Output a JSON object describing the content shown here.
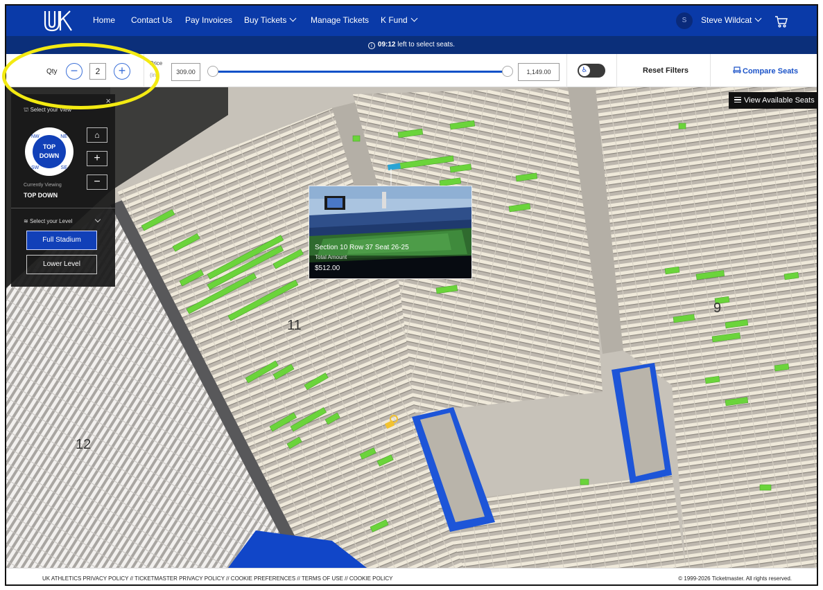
{
  "nav": {
    "logo": "UK",
    "items": [
      {
        "label": "Home",
        "dropdown": false
      },
      {
        "label": "Contact Us",
        "dropdown": false
      },
      {
        "label": "Pay Invoices",
        "dropdown": false
      },
      {
        "label": "Buy Tickets",
        "dropdown": true
      },
      {
        "label": "Manage Tickets",
        "dropdown": false
      },
      {
        "label": "K Fund",
        "dropdown": true
      }
    ],
    "user_initial": "S",
    "user_name": "Steve Wildcat",
    "cart_icon": "cart-icon"
  },
  "timer": {
    "icon": "info-icon",
    "time": "09:12",
    "text": " left to select seats."
  },
  "filters": {
    "qty_label": "Qty",
    "qty_value": "2",
    "minus": "−",
    "plus": "+",
    "price_label": "Price",
    "price_sub": "(in",
    "price_min": "309.00",
    "price_max": "1,149.00",
    "accessibility_symbol": "♿",
    "reset_label": "Reset Filters",
    "compare_label": "Compare Seats"
  },
  "view_panel": {
    "close": "×",
    "select_view_label": "Select your View",
    "compass_center": [
      "TOP",
      "DOWN"
    ],
    "compass_dirs": [
      "NW",
      "NE",
      "SW",
      "SE"
    ],
    "currently_viewing_label": "Currently Viewing",
    "current_view": "TOP DOWN",
    "home_icon": "home-icon",
    "zoom_in": "+",
    "zoom_out": "−",
    "select_level_label": "Select your Level",
    "levels": [
      "Full Stadium",
      "Lower Level"
    ],
    "selected_level": "Full Stadium"
  },
  "map": {
    "section_labels": [
      "11",
      "9",
      "12"
    ],
    "view_available_label": "View Available Seats",
    "available_color": "#6bd43b",
    "selected_seat_color": "#2aa4d4",
    "pin_color": "#f2c230"
  },
  "popup": {
    "section_text": "Section 10 Row 37 Seat 26-25",
    "total_label": "Total Amount",
    "price": "$512.00"
  },
  "footer": {
    "links": [
      "UK ATHLETICS PRIVACY POLICY",
      "TICKETMASTER PRIVACY POLICY",
      "COOKIE PREFERENCES",
      "TERMS OF USE",
      "COOKIE POLICY"
    ],
    "separator": " // ",
    "copyright": "© 1999-2026 Ticketmaster. All rights reserved."
  },
  "colors": {
    "nav_blue": "#0a3aa8",
    "timer_blue": "#0b2f7a",
    "highlight": "#f3ea12"
  }
}
